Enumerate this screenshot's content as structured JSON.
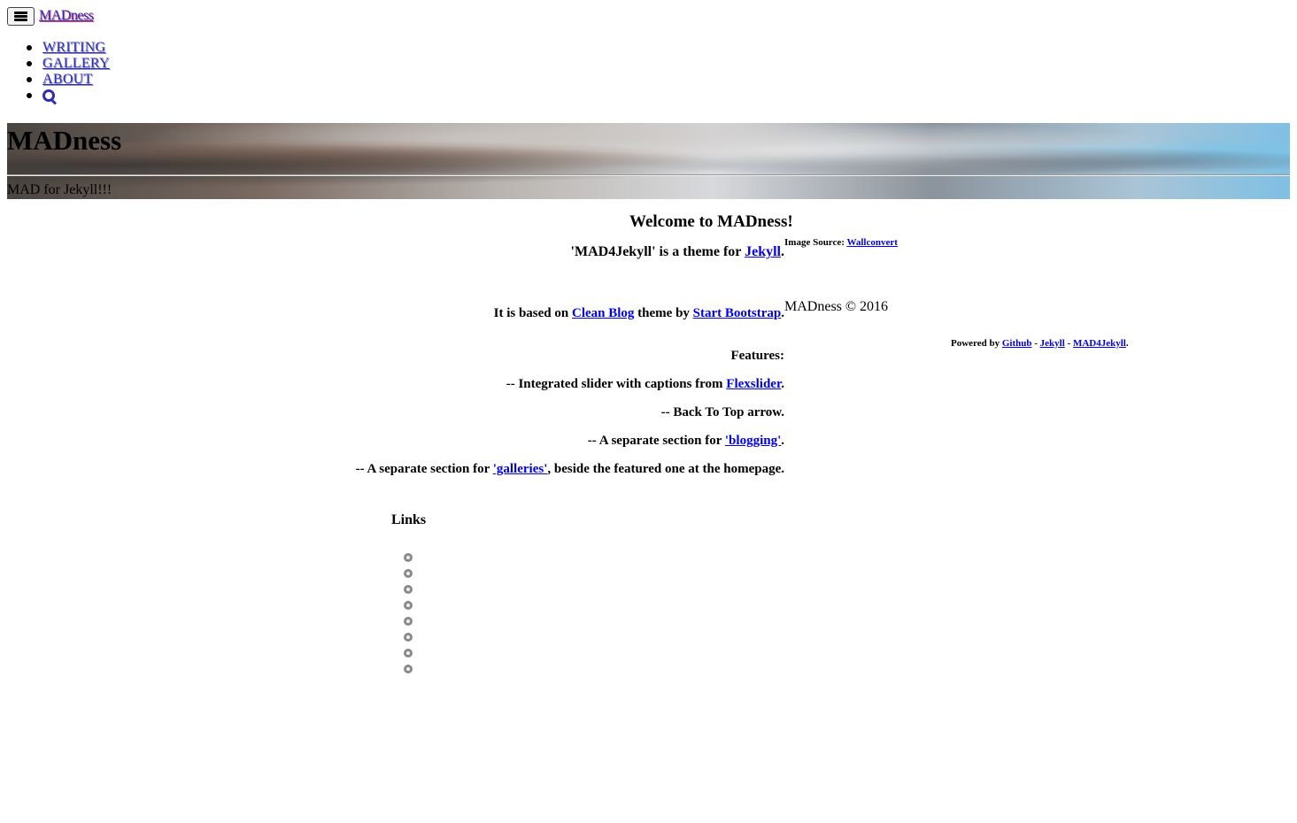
{
  "navbar": {
    "brand": "MADness",
    "items": [
      {
        "label": "WRITING"
      },
      {
        "label": "GALLERY"
      },
      {
        "label": "ABOUT"
      }
    ],
    "search_icon": "search-icon",
    "menu_icon": "hamburger-icon"
  },
  "header": {
    "title": "MADness",
    "subtitle": "MAD for Jekyll!!!"
  },
  "intro": {
    "welcome": "Welcome to MADness!",
    "theme_prefix": "'MAD4Jekyll' is a theme for ",
    "theme_link": "Jekyll",
    "theme_suffix": ".",
    "based_prefix": "It is based on ",
    "based_link1": "Clean Blog",
    "based_mid": " theme by ",
    "based_link2": "Start Bootstrap",
    "based_suffix": ".",
    "features_title": "Features:",
    "feature1_prefix": "-- Integrated slider with captions from ",
    "feature1_link": "Flexslider",
    "feature1_suffix": ".",
    "feature2": "-- Back To Top arrow.",
    "feature3_prefix": "-- A separate section for ",
    "feature3_link": "'blogging'",
    "feature3_suffix": ".",
    "feature4_prefix": "-- A separate section for ",
    "feature4_link": "'galleries'",
    "feature4_suffix": ", beside the featured one at the homepage."
  },
  "sidebar": {
    "image_source_label": "Image Source: ",
    "image_source_link": "Wallconvert",
    "copyright": "MADness © 2016",
    "powered_prefix": "Powered by ",
    "powered_link1": "Github",
    "sep1": " - ",
    "powered_link2": "Jekyll",
    "sep2": " - ",
    "powered_link3": "MAD4Jekyll",
    "powered_suffix": "."
  },
  "links": {
    "title": "Links",
    "icons": [
      "twitter-icon",
      "facebook-icon",
      "github-icon",
      "instagram-icon",
      "linkedin-icon",
      "pinterest-icon",
      "flickr-icon",
      "email-icon"
    ]
  }
}
